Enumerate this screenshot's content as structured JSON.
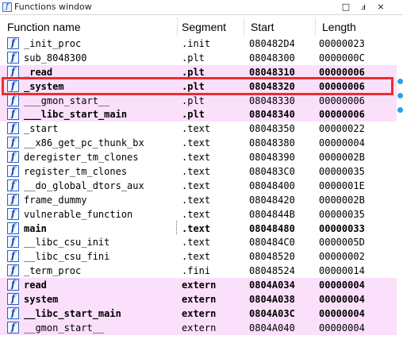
{
  "window": {
    "title": "Functions window",
    "icon": "function-icon",
    "buttons": [
      "□",
      "ⅎ",
      "×"
    ]
  },
  "columns": [
    "Function name",
    "Segment",
    "Start",
    "Length"
  ],
  "rows": [
    {
      "name": "_init_proc",
      "segment": ".init",
      "start": "080482D4",
      "length": "00000023",
      "pink": false,
      "bold": false
    },
    {
      "name": "sub_8048300",
      "segment": ".plt",
      "start": "08048300",
      "length": "0000000C",
      "pink": false,
      "bold": false
    },
    {
      "name": "_read",
      "segment": ".plt",
      "start": "08048310",
      "length": "00000006",
      "pink": true,
      "bold": true
    },
    {
      "name": "_system",
      "segment": ".plt",
      "start": "08048320",
      "length": "00000006",
      "pink": true,
      "bold": true
    },
    {
      "name": "___gmon_start__",
      "segment": ".plt",
      "start": "08048330",
      "length": "00000006",
      "pink": true,
      "bold": false
    },
    {
      "name": "___libc_start_main",
      "segment": ".plt",
      "start": "08048340",
      "length": "00000006",
      "pink": true,
      "bold": true
    },
    {
      "name": "_start",
      "segment": ".text",
      "start": "08048350",
      "length": "00000022",
      "pink": false,
      "bold": false
    },
    {
      "name": "__x86_get_pc_thunk_bx",
      "segment": ".text",
      "start": "08048380",
      "length": "00000004",
      "pink": false,
      "bold": false
    },
    {
      "name": "deregister_tm_clones",
      "segment": ".text",
      "start": "08048390",
      "length": "0000002B",
      "pink": false,
      "bold": false
    },
    {
      "name": "register_tm_clones",
      "segment": ".text",
      "start": "080483C0",
      "length": "00000035",
      "pink": false,
      "bold": false
    },
    {
      "name": "__do_global_dtors_aux",
      "segment": ".text",
      "start": "08048400",
      "length": "0000001E",
      "pink": false,
      "bold": false
    },
    {
      "name": "frame_dummy",
      "segment": ".text",
      "start": "08048420",
      "length": "0000002B",
      "pink": false,
      "bold": false
    },
    {
      "name": "vulnerable_function",
      "segment": ".text",
      "start": "0804844B",
      "length": "00000035",
      "pink": false,
      "bold": false
    },
    {
      "name": "main",
      "segment": ".text",
      "start": "08048480",
      "length": "00000033",
      "pink": false,
      "bold": true
    },
    {
      "name": "__libc_csu_init",
      "segment": ".text",
      "start": "080484C0",
      "length": "0000005D",
      "pink": false,
      "bold": false
    },
    {
      "name": "__libc_csu_fini",
      "segment": ".text",
      "start": "08048520",
      "length": "00000002",
      "pink": false,
      "bold": false
    },
    {
      "name": "_term_proc",
      "segment": ".fini",
      "start": "08048524",
      "length": "00000014",
      "pink": false,
      "bold": false
    },
    {
      "name": "read",
      "segment": "extern",
      "start": "0804A034",
      "length": "00000004",
      "pink": true,
      "bold": true
    },
    {
      "name": "system",
      "segment": "extern",
      "start": "0804A038",
      "length": "00000004",
      "pink": true,
      "bold": true
    },
    {
      "name": "__libc_start_main",
      "segment": "extern",
      "start": "0804A03C",
      "length": "00000004",
      "pink": true,
      "bold": true
    },
    {
      "name": "__gmon_start__",
      "segment": "extern",
      "start": "0804A040",
      "length": "00000004",
      "pink": true,
      "bold": false
    }
  ],
  "row_icon_glyph": "f",
  "colors": {
    "pink_row": "#fbe0fb",
    "highlight": "#e82f2f",
    "icon_blue": "#2f5fc4"
  }
}
